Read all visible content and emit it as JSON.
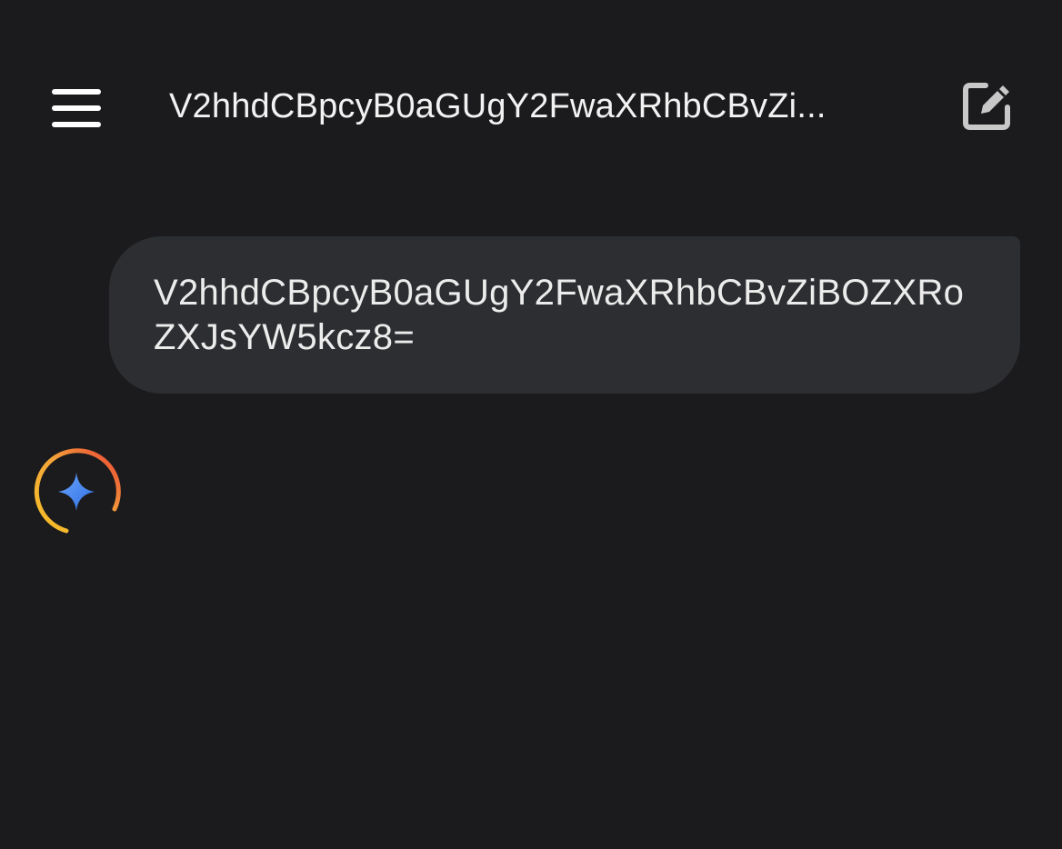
{
  "header": {
    "menu_icon": "hamburger-menu-icon",
    "title": "V2hhdCBpcyB0aGUgY2FwaXRhbCBvZi...",
    "edit_icon": "edit-new-chat-icon"
  },
  "conversation": {
    "user_message": "V2hhdCBpcyB0aGUgY2FwaXRhbCBvZiBOZXRoZXJsYW5kcz8=",
    "assistant_avatar_icon": "sparkle-loading-icon"
  },
  "colors": {
    "background": "#1b1b1d",
    "bubble": "#2d2e31",
    "text": "#ececec",
    "sparkle_blue": "#4a8af4",
    "ring_yellow": "#f6c026",
    "ring_red": "#ea4335"
  }
}
